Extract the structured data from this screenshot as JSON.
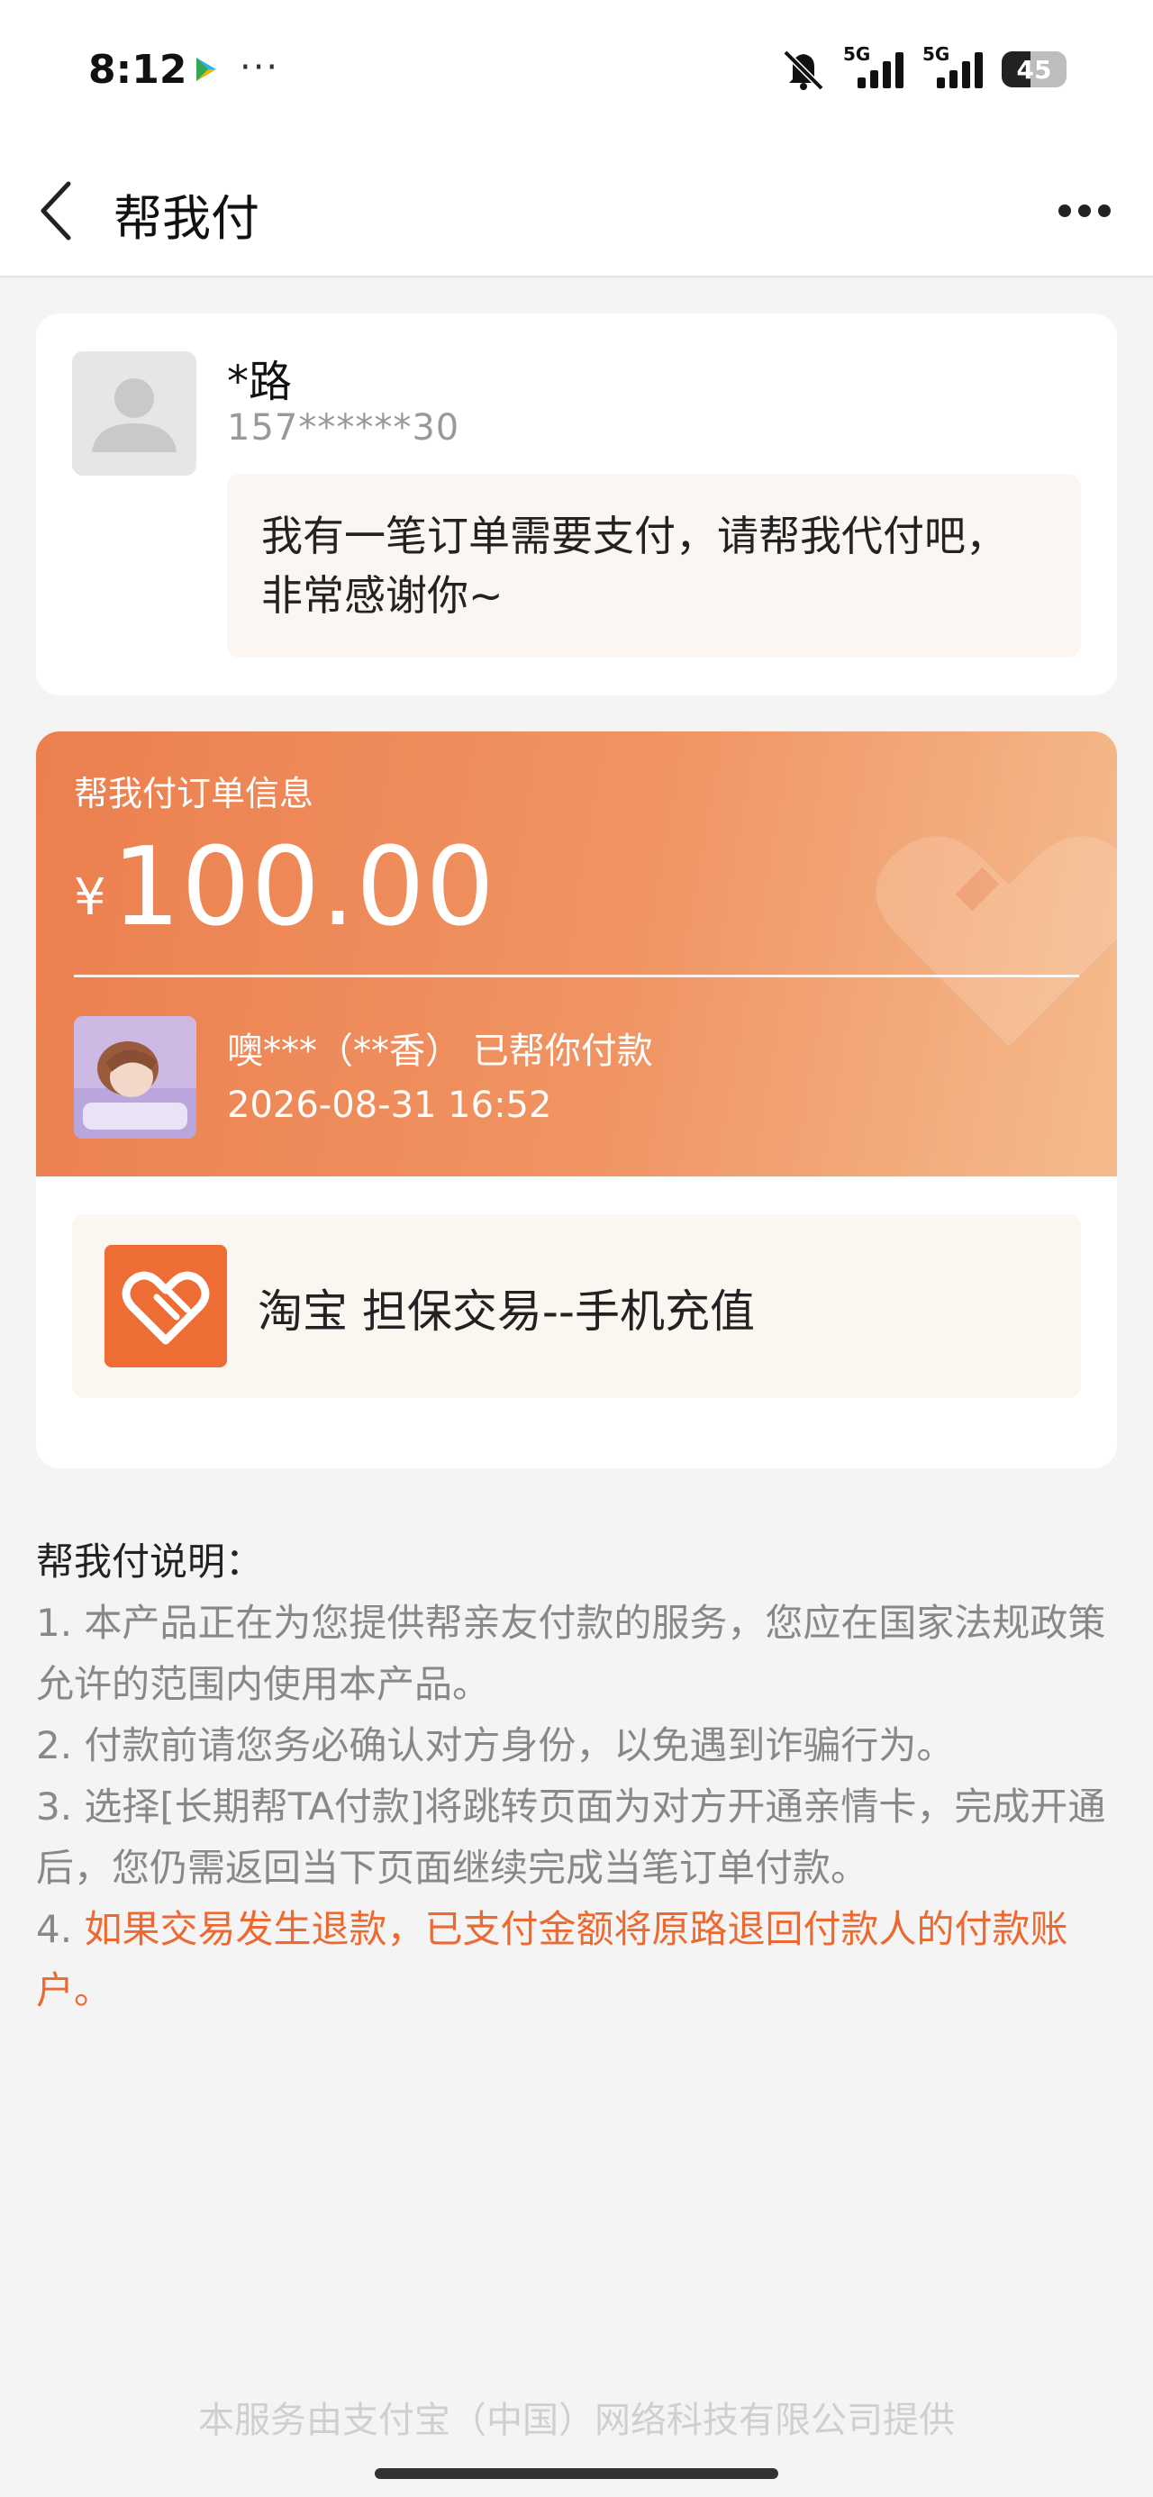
{
  "status_bar": {
    "time": "8:12",
    "dots": "···",
    "network_1": "5G",
    "network_2": "5G",
    "battery": "45"
  },
  "header": {
    "title": "帮我付"
  },
  "requester": {
    "name": "*路",
    "phone": "157******30",
    "message": "我有一笔订单需要支付，请帮我代付吧，非常感谢你~"
  },
  "order": {
    "section_title": "帮我付订单信息",
    "currency": "¥",
    "amount": "100.00",
    "payer_status": "噢***（**香） 已帮你付款",
    "paid_time": "2026-08-31 16:52",
    "merchant": "淘宝 担保交易--手机充值"
  },
  "notes": {
    "title": "帮我付说明：",
    "item1": "1. 本产品正在为您提供帮亲友付款的服务，您应在国家法规政策允许的范围内使用本产品。",
    "item2": "2. 付款前请您务必确认对方身份，以免遇到诈骗行为。",
    "item3": "3. 选择[长期帮TA付款]将跳转页面为对方开通亲情卡，完成开通后，您仍需返回当下页面继续完成当笔订单付款。",
    "item4_num": "4. ",
    "item4": "如果交易发生退款，已支付金额将原路退回付款人的付款账户。"
  },
  "footer": {
    "text": "本服务由支付宝（中国）网络科技有限公司提供"
  },
  "colors": {
    "accent": "#ec6a32",
    "orange_start": "#ec7f4e",
    "orange_end": "#f5bb8d"
  },
  "icons": {
    "back": "chevron-left-icon",
    "more": "more-dots-icon",
    "merchant": "taobao-guarantee-icon"
  }
}
